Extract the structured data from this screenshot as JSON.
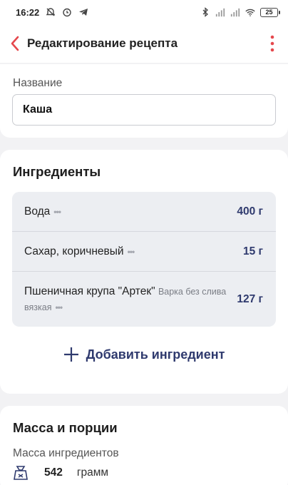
{
  "status_bar": {
    "time": "16:22",
    "battery": "25",
    "icons": [
      "do-not-disturb-icon",
      "alarm-icon",
      "telegram-icon",
      "bluetooth-icon",
      "signal-icon",
      "signal-icon",
      "wifi-icon",
      "battery-icon"
    ]
  },
  "toolbar": {
    "title": "Редактирование рецепта",
    "back_icon": "chevron-left-icon",
    "menu_icon": "more-vertical-icon"
  },
  "name_section": {
    "label": "Название",
    "value": "Каша"
  },
  "ingredients": {
    "title": "Ингредиенты",
    "items": [
      {
        "name": "Вода",
        "detail": "",
        "amount": "400 г"
      },
      {
        "name": "Сахар, коричневый",
        "detail": "",
        "amount": "15 г"
      },
      {
        "name": "Пшеничная крупа \"Артек\"",
        "detail": "Варка без слива вязкая",
        "amount": "127 г"
      }
    ],
    "more_marker": "•••",
    "add_label": "Добавить ингредиент"
  },
  "mass_section": {
    "title": "Масса и порции",
    "label": "Масса ингредиентов",
    "value": "542",
    "unit": "грамм"
  },
  "colors": {
    "accent_red": "#e5484d",
    "accent_navy": "#2f3a6e",
    "background": "#f2f2f4"
  }
}
